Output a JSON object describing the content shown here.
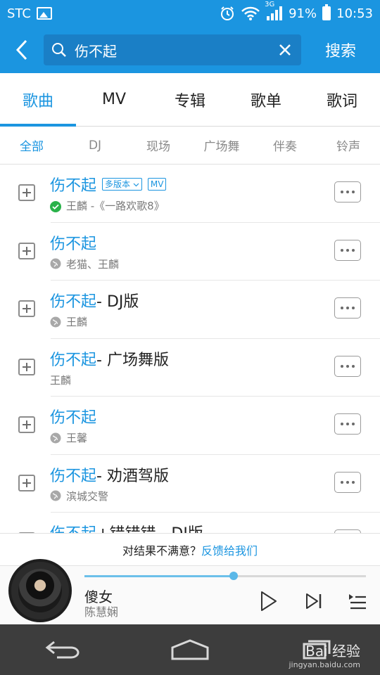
{
  "status_bar": {
    "carrier": "STC",
    "network": "3G",
    "battery": "91%",
    "time": "10:53",
    "icons": [
      "image-icon",
      "alarm-icon",
      "wifi-icon",
      "signal-icon",
      "battery-icon"
    ]
  },
  "search": {
    "query": "伤不起",
    "button_label": "搜索"
  },
  "tabs": [
    "歌曲",
    "MV",
    "专辑",
    "歌单",
    "歌词"
  ],
  "active_tab": 0,
  "subtabs": [
    "全部",
    "DJ",
    "现场",
    "广场舞",
    "伴奏",
    "铃声"
  ],
  "active_subtab": 0,
  "songs": [
    {
      "name": "伤不起",
      "suffix": "",
      "tags": [
        "多版本",
        "MV"
      ],
      "subtitle": "王麟 -《一路欢歌8》",
      "source_icon": "check-circle-icon"
    },
    {
      "name": "伤不起",
      "suffix": "",
      "tags": [],
      "subtitle": "老猫、王麟",
      "source_icon": "globe-icon"
    },
    {
      "name": "伤不起",
      "suffix": " - DJ版",
      "tags": [],
      "subtitle": "王麟",
      "source_icon": "globe-icon"
    },
    {
      "name": "伤不起",
      "suffix": " - 广场舞版",
      "tags": [],
      "subtitle": "王麟",
      "source_icon": "none"
    },
    {
      "name": "伤不起",
      "suffix": "",
      "tags": [],
      "subtitle": "王馨",
      "source_icon": "globe-icon"
    },
    {
      "name": "伤不起",
      "suffix": " - 劝酒驾版",
      "tags": [],
      "subtitle": "滨城交警",
      "source_icon": "globe-icon"
    },
    {
      "name": "伤不起",
      "suffix": "+错错错 - DJ版",
      "tags": [],
      "subtitle": "",
      "source_icon": "none"
    }
  ],
  "feedback": {
    "prompt": "对结果不满意？",
    "link": "反馈给我们"
  },
  "player": {
    "title": "傻女",
    "artist": "陈慧娴",
    "progress": 0.53
  },
  "watermark": {
    "brand": "Bai 经验",
    "url": "jingyan.baidu.com"
  },
  "colors": {
    "accent": "#1b95e0",
    "verified": "#2ab24a",
    "navbar": "#3d3d3d"
  }
}
